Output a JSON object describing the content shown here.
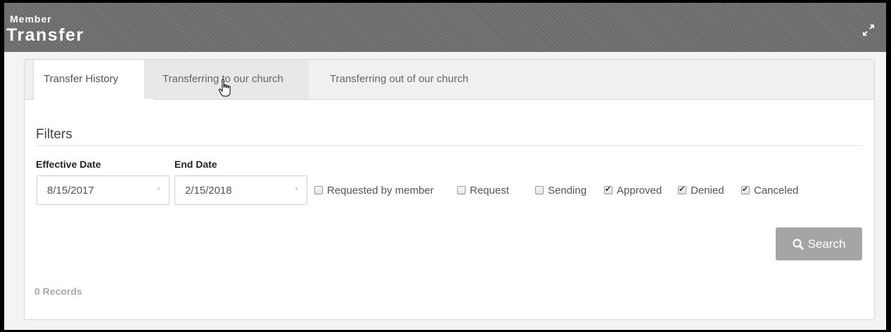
{
  "header": {
    "subtitle": "Member",
    "title": "Transfer",
    "expand_icon": "expand-icon"
  },
  "tabs": [
    {
      "label": "Transfer History",
      "active": true
    },
    {
      "label": "Transferring to our church",
      "active": false
    },
    {
      "label": "Transferring out of our church",
      "active": false
    }
  ],
  "filters": {
    "title": "Filters",
    "effective_date": {
      "label": "Effective Date",
      "value": "8/15/2017"
    },
    "end_date": {
      "label": "End Date",
      "value": "2/15/2018"
    },
    "required_marker": "*",
    "checkboxes": [
      {
        "label": "Requested by member",
        "checked": false
      },
      {
        "label": "Request",
        "checked": false
      },
      {
        "label": "Sending",
        "checked": false
      },
      {
        "label": "Approved",
        "checked": true
      },
      {
        "label": "Denied",
        "checked": true
      },
      {
        "label": "Canceled",
        "checked": true
      }
    ]
  },
  "search_button": {
    "label": "Search",
    "icon": "search-icon"
  },
  "records_text": "0 Records",
  "colors": {
    "header_bg": "#6f6f6f",
    "search_button_bg": "#a5a5a5"
  }
}
